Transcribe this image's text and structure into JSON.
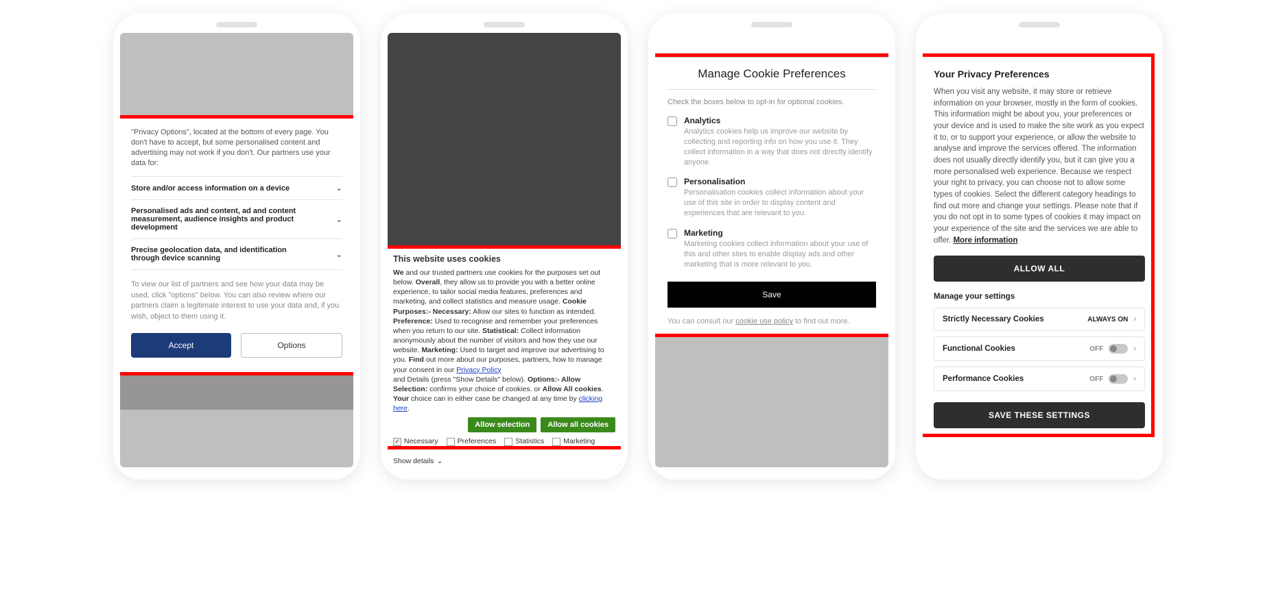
{
  "phone1": {
    "intro": "\"Privacy Options\", located at the bottom of every page. You don't have to accept, but some personalised content and advertising may not work if you don't. Our partners use your data for:",
    "rows": [
      "Store and/or access information on a device",
      "Personalised ads and content, ad and content measurement, audience insights and product development",
      "Precise geolocation data, and identification through device scanning"
    ],
    "note": "To view our list of partners and see how your data may be used, click \"options\" below. You can also review where our partners claim a legitimate interest to use your data and, if you wish, object to them using it.",
    "accept": "Accept",
    "options": "Options"
  },
  "phone2": {
    "title": "This website uses cookies",
    "body_pieces": {
      "p1_we": "We",
      "p1_a": " and our trusted partners use cookies for the purposes set out below. ",
      "p1_overall": "Overall",
      "p1_b": ", they allow us to provide you with a better online experience, to tailor social media features, preferences and marketing, and collect statistics and measure usage. ",
      "p1_cp": "Cookie Purposes:- Necessary:",
      "p1_c": " Allow our sites to function as intended. ",
      "p1_pref": "Preference:",
      "p1_d": " Used to recognise and remember your preferences when you return to our site. ",
      "p1_stat": "Statistical:",
      "p1_e": " Collect information anonymously about the number of visitors and how they use our website. ",
      "p1_mkt": "Marketing:",
      "p1_f": " Used to target and improve our advertising to you. ",
      "p1_find": "Find",
      "p1_g": " out more about our purposes, partners, how to manage your consent in our ",
      "p1_pp": "Privacy Policy",
      "p1_h": " and Details (press \"Show Details\" below). ",
      "p1_opt": "Options:- Allow Selection:",
      "p1_i": " confirms your choice of cookies. or ",
      "p1_allc": "Allow All cookies",
      "p1_j": ". ",
      "p1_your": "Your",
      "p1_k": " choice can in either case be changed at any time by ",
      "p1_click": "clicking here",
      "p1_l": "."
    },
    "btn_allow_selection": "Allow selection",
    "btn_allow_all": "Allow all cookies",
    "checks": {
      "necessary": "Necessary",
      "preferences": "Preferences",
      "statistics": "Statistics",
      "marketing": "Marketing"
    },
    "show_details": "Show details"
  },
  "phone3": {
    "title": "Manage Cookie Preferences",
    "sub": "Check the boxes below to opt-in for optional cookies.",
    "opts": [
      {
        "label": "Analytics",
        "desc": "Analytics cookies help us improve our website by collecting and reporting info on how you use it. They collect information in a way that does not directly identify anyone."
      },
      {
        "label": "Personalisation",
        "desc": "Personalisation cookies collect information about your use of this site in order to display content and experiences that are relevant to you."
      },
      {
        "label": "Marketing",
        "desc": "Marketing cookies collect information about your use of this and other sites to enable display ads and other marketing that is more relevant to you."
      }
    ],
    "save": "Save",
    "foot_a": "You can consult our ",
    "foot_link": "cookie use policy",
    "foot_b": " to find out more."
  },
  "phone4": {
    "title": "Your Privacy Preferences",
    "body_a": "When you visit any website, it may store or retrieve information on your browser, mostly in the form of cookies. This information might be about you, your preferences or your device and is used to make the site work as you expect it to, or to support your experience, or allow the website to analyse and improve the services offered. The information does not usually directly identify you, but it can give you a more personalised web experience. Because we respect your right to privacy, you can choose not to allow some types of cookies. Select the different category headings to find out more and change your settings. Please note that if you do not opt in to some types of cookies it may impact on your experience of the site and the services we are able to offer. ",
    "more_info": "More information",
    "allow_all": "ALLOW ALL",
    "manage": "Manage your settings",
    "rows": [
      {
        "label": "Strictly Necessary Cookies",
        "status": "ALWAYS ON",
        "toggle": false
      },
      {
        "label": "Functional Cookies",
        "status": "OFF",
        "toggle": true
      },
      {
        "label": "Performance Cookies",
        "status": "OFF",
        "toggle": true
      }
    ],
    "save": "SAVE THESE SETTINGS"
  }
}
